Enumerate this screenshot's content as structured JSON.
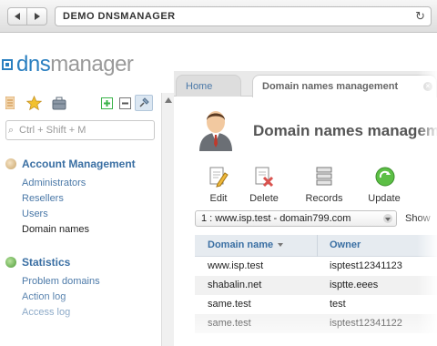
{
  "browser": {
    "address": "DEMO DNSMANAGER",
    "back_icon": "back-arrow-icon",
    "forward_icon": "forward-arrow-icon",
    "reload_icon": "reload-icon"
  },
  "logo": {
    "part1": "dns",
    "part2": "manager"
  },
  "sidebar": {
    "search_placeholder": "Ctrl + Shift + M",
    "sections": [
      {
        "title": "Account Management",
        "items": [
          {
            "label": "Administrators"
          },
          {
            "label": "Resellers"
          },
          {
            "label": "Users"
          },
          {
            "label": "Domain names",
            "active": true
          }
        ]
      },
      {
        "title": "Statistics",
        "items": [
          {
            "label": "Problem domains"
          },
          {
            "label": "Action log"
          },
          {
            "label": "Access log"
          }
        ]
      }
    ]
  },
  "tabs": [
    {
      "label": "Home"
    },
    {
      "label": "Domain names management",
      "active": true
    }
  ],
  "page": {
    "title": "Domain names managem",
    "actions": [
      {
        "label": "Edit"
      },
      {
        "label": "Delete"
      },
      {
        "label": "Records"
      },
      {
        "label": "Update"
      }
    ],
    "filter_value": "1 : www.isp.test - domain799.com",
    "show_label": "Show"
  },
  "table": {
    "columns": [
      "Domain name",
      "Owner"
    ],
    "rows": [
      [
        "www.isp.test",
        "isptest12341123"
      ],
      [
        "shabalin.net",
        "isptte.eees"
      ],
      [
        "same.test",
        "test"
      ],
      [
        "same.test",
        "isptest12341122"
      ]
    ]
  },
  "colors": {
    "accent": "#3a6fa3",
    "logo_blue": "#2a7fc0",
    "add_green": "#3bb34a",
    "update_green": "#4caf3a",
    "delete_red": "#d9534f"
  }
}
